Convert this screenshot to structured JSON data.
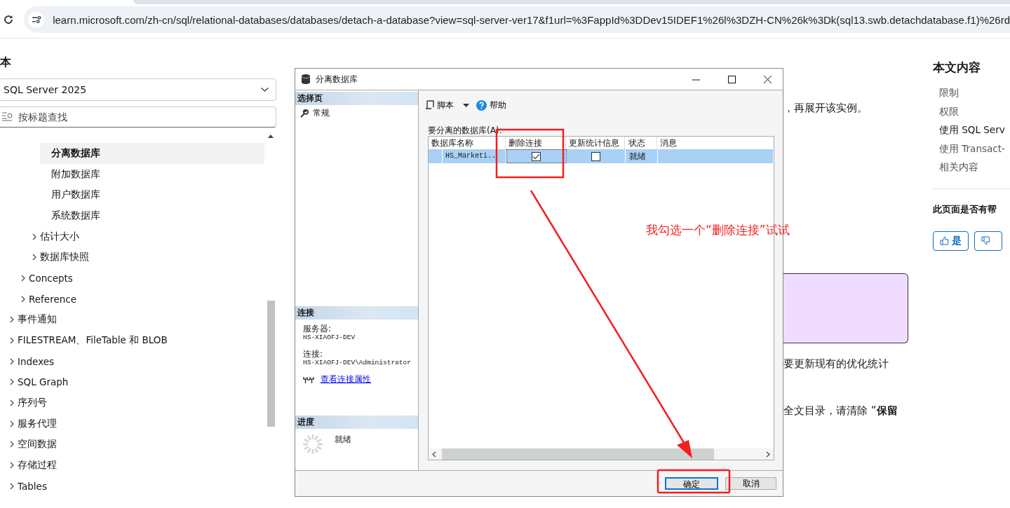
{
  "browser": {
    "url": "learn.microsoft.com/zh-cn/sql/relational-databases/databases/detach-a-database?view=sql-server-ver17&f1url=%3FappId%3DDev15IDEF1%26l%3DZH-CN%26k%3Dk(sql13.swb.detachdatabase.f1)%26rd"
  },
  "sidebar": {
    "heading": "本",
    "version_select": {
      "value": "SQL Server 2025"
    },
    "search": {
      "placeholder": "按标题查找"
    },
    "tree": [
      {
        "children": [
          {
            "children": [
              {
                "children": [
                  {
                    "label": "分离数据库",
                    "selected": true
                  },
                  {
                    "label": "附加数据库",
                    "selected": false
                  },
                  {
                    "label": "用户数据库",
                    "selected": false
                  },
                  {
                    "label": "系统数据库",
                    "selected": false
                  }
                ]
              },
              {
                "label": "估计大小",
                "expanded": false,
                "selected": false
              },
              {
                "label": "数据库快照",
                "expanded": false,
                "selected": false
              }
            ]
          },
          {
            "label": "Concepts",
            "expanded": false,
            "selected": false
          },
          {
            "label": "Reference",
            "expanded": false,
            "selected": false
          }
        ]
      },
      {
        "label": "事件通知",
        "expanded": false,
        "selected": false
      },
      {
        "label": "FILESTREAM、FileTable 和 BLOB",
        "expanded": false,
        "selected": false
      },
      {
        "label": "Indexes",
        "expanded": false,
        "selected": false
      },
      {
        "label": "SQL Graph",
        "expanded": false,
        "selected": false
      },
      {
        "label": "序列号",
        "expanded": false,
        "selected": false
      },
      {
        "label": "服务代理",
        "expanded": false,
        "selected": false
      },
      {
        "label": "空间数据",
        "expanded": false,
        "selected": false
      },
      {
        "label": "存储过程",
        "expanded": false,
        "selected": false
      },
      {
        "label": "Tables",
        "expanded": false,
        "selected": false
      }
    ]
  },
  "article": {
    "paragraphs": [
      "，再展开该实例。",
      "要更新现有的优化统计",
      "全文目录，请清除 “**保留**"
    ]
  },
  "toc": {
    "heading": "本文内容",
    "items": [
      {
        "label": "限制",
        "selected": false
      },
      {
        "label": "权限",
        "selected": false
      },
      {
        "label": "使用 SQL Serv",
        "selected": true
      },
      {
        "label": "使用 Transact-",
        "selected": false
      },
      {
        "label": "相关内容",
        "selected": false
      }
    ],
    "feedback": {
      "question": "此页面是否有帮",
      "buttons": [
        {
          "kind": "yes",
          "label": "是"
        },
        {
          "kind": "no"
        }
      ]
    }
  },
  "dialog": {
    "title": "分离数据库",
    "select_page": {
      "heading": "选择页",
      "items": [
        {
          "label": "常规"
        }
      ]
    },
    "connection": {
      "heading": "连接",
      "fields": [
        {
          "label": "服务器:",
          "value": "HS-XIAOFJ-DEV"
        },
        {
          "label": "连接:",
          "value": "HS-XIAOFJ-DEV\\Administrator"
        }
      ],
      "link": "查看连接属性"
    },
    "progress": {
      "heading": "进度",
      "status": "就绪"
    },
    "toolbar": [
      {
        "kind": "script",
        "label": "脚本"
      },
      {
        "kind": "help",
        "label": "帮助"
      }
    ],
    "grid": {
      "label": "要分离的数据库(A):",
      "columns": [
        "数据库名称",
        "删除连接",
        "更新统计信息",
        "状态",
        "消息"
      ],
      "rows": [
        {
          "name": "HS_Marketi..",
          "drop_connections": true,
          "update_statistics": false,
          "status": "就绪",
          "selected": true
        }
      ]
    },
    "buttons": [
      {
        "kind": "default",
        "label": "确定"
      },
      {
        "kind": "normal",
        "label": "取消"
      }
    ]
  },
  "annotation": {
    "note": "我勾选一个“删除连接”试试"
  }
}
